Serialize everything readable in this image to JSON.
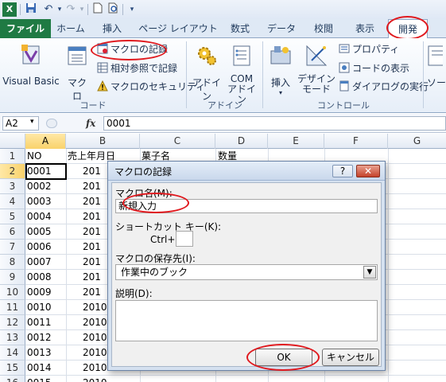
{
  "qat": {
    "icons": [
      "excel-logo-icon",
      "save-icon",
      "undo-icon",
      "redo-icon",
      "new-document-icon",
      "print-preview-icon",
      "customize-qat-icon"
    ]
  },
  "tabs": [
    {
      "label": "ファイル"
    },
    {
      "label": "ホーム"
    },
    {
      "label": "挿入"
    },
    {
      "label": "ページ レイアウト"
    },
    {
      "label": "数式"
    },
    {
      "label": "データ"
    },
    {
      "label": "校閲"
    },
    {
      "label": "表示"
    },
    {
      "label": "開発"
    }
  ],
  "ribbon": {
    "code": {
      "visual_basic": "Visual Basic",
      "macro": "マクロ",
      "record_macro": "マクロの記録",
      "relative_ref": "相対参照で記録",
      "macro_security": "マクロのセキュリティ",
      "group_label": "コード"
    },
    "addins": {
      "addin": "アドイン",
      "com_line1": "COM",
      "com_line2": "アドイン",
      "group_label": "アドイン"
    },
    "controls": {
      "insert": "挿入",
      "design_line1": "デザイン",
      "design_line2": "モード",
      "properties": "プロパティ",
      "view_code": "コードの表示",
      "run_dialog": "ダイアログの実行",
      "group_label": "コントロール"
    },
    "source_partial": "ソー"
  },
  "formula_bar": {
    "name_box": "A2",
    "fx": "fx",
    "value": "0001"
  },
  "columns": [
    "A",
    "B",
    "C",
    "D",
    "E",
    "F",
    "G"
  ],
  "rows": [
    "1",
    "2",
    "3",
    "4",
    "5",
    "6",
    "7",
    "8",
    "9",
    "10",
    "11",
    "12",
    "13",
    "14",
    "15",
    "16"
  ],
  "headers": {
    "a": "NO",
    "b": "売上年月日",
    "c": "菓子名",
    "d": "数量"
  },
  "col_a": [
    "0001",
    "0002",
    "0003",
    "0004",
    "0005",
    "0006",
    "0007",
    "0008",
    "0009",
    "0010",
    "0011",
    "0012",
    "0013",
    "0014",
    "0015"
  ],
  "col_b": [
    "201",
    "201",
    "201",
    "201",
    "201",
    "201",
    "201",
    "201",
    "201",
    "2010",
    "2010",
    "2010",
    "2010",
    "2010",
    "2010"
  ],
  "dialog": {
    "title": "マクロの記録",
    "help": "?",
    "close": "✕",
    "macro_name_label": "マクロ名(M):",
    "macro_name_value": "新規入力",
    "shortcut_label": "ショートカット キー(K):",
    "ctrl_label": "Ctrl+",
    "shortcut_value": "",
    "store_label": "マクロの保存先(I):",
    "store_value": "作業中のブック",
    "desc_label": "説明(D):",
    "desc_value": "",
    "ok": "OK",
    "cancel": "キャンセル"
  }
}
